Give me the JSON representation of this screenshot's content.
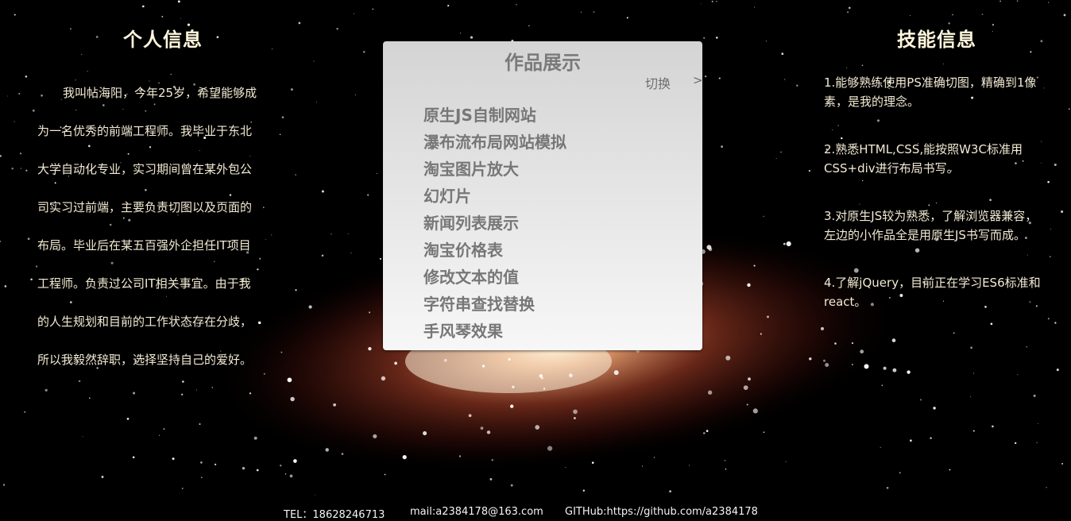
{
  "personal": {
    "title": "个人信息",
    "text": "我叫帖海阳，今年25岁，希望能够成为一名优秀的前端工程师。我毕业于东北大学自动化专业，实习期间曾在某外包公司实习过前端，主要负责切图以及页面的布局。毕业后在某五百强外企担任IT项目工程师。负责过公司IT相关事宜。由于我的人生规划和目前的工作状态存在分歧，所以我毅然辞职，选择坚持自己的爱好。"
  },
  "works": {
    "title": "作品展示",
    "switch_label": "切换",
    "switch_arrow": ">",
    "items": [
      "原生JS自制网站",
      "瀑布流布局网站模拟",
      "淘宝图片放大",
      "幻灯片",
      "新闻列表展示",
      "淘宝价格表",
      "修改文本的值",
      "字符串查找替换",
      "手风琴效果"
    ]
  },
  "skills": {
    "title": "技能信息",
    "items": [
      "1.能够熟练使用PS准确切图，精确到1像素，是我的理念。",
      "2.熟悉HTML,CSS,能按照W3C标准用CSS+div进行布局书写。",
      "3.对原生JS较为熟悉，了解浏览器兼容，左边的小作品全是用原生JS书写而成。",
      "4.了解jQuery，目前正在学习ES6标准和react。"
    ]
  },
  "footer": {
    "tel": "TEL：18628246713",
    "mail": "mail:a2384178@163.com",
    "github": "GITHub:https://github.com/a2384178"
  }
}
